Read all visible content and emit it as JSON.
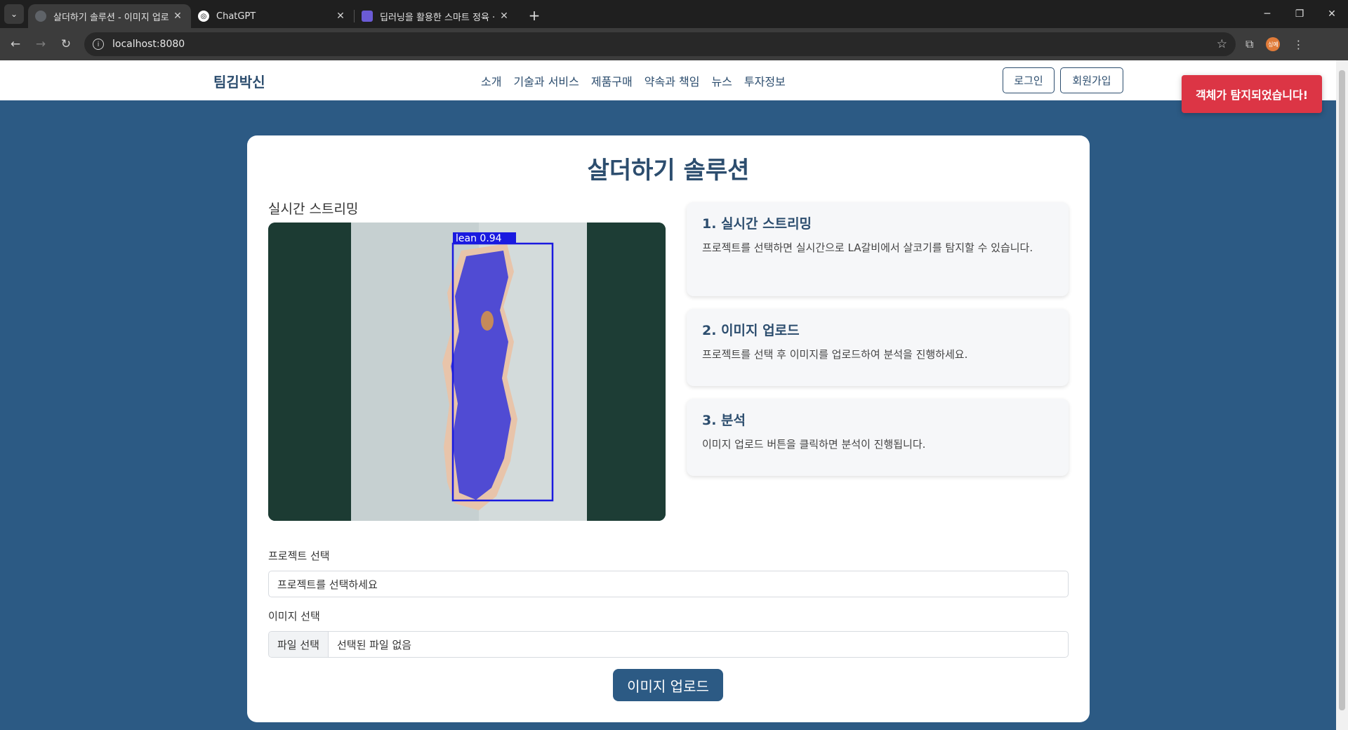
{
  "browser": {
    "tabs": [
      {
        "title": "살더하기 솔루션 - 이미지 업로",
        "active": true
      },
      {
        "title": "ChatGPT",
        "active": false
      },
      {
        "title": "딥러닝을 활용한 스마트 정육 ·",
        "active": false
      }
    ],
    "url": "localhost:8080",
    "profile_label": "싱예"
  },
  "site": {
    "brand": "팀김박신",
    "menu": [
      "소개",
      "기술과 서비스",
      "제품구매",
      "약속과 책임",
      "뉴스",
      "투자정보"
    ],
    "login": "로그인",
    "signup": "회원가입"
  },
  "alert": "객체가 탐지되었습니다!",
  "page": {
    "title": "살더하기 솔루션",
    "stream_label": "실시간 스트리밍",
    "detection": {
      "label": "lean 0.94",
      "confidence": 0.94
    },
    "steps": [
      {
        "title": "1. 실시간 스트리밍",
        "desc": "프로젝트를 선택하면 실시간으로 LA갈비에서 살코기를 탐지할 수 있습니다."
      },
      {
        "title": "2. 이미지 업로드",
        "desc": "프로젝트를 선택 후 이미지를 업로드하여 분석을 진행하세요."
      },
      {
        "title": "3. 분석",
        "desc": "이미지 업로드 버튼을 클릭하면 분석이 진행됩니다."
      }
    ],
    "project_label": "프로젝트 선택",
    "project_placeholder": "프로젝트를 선택하세요",
    "image_label": "이미지 선택",
    "file_button": "파일 선택",
    "file_status": "선택된 파일 없음",
    "upload_button": "이미지 업로드"
  },
  "colors": {
    "page_bg": "#2c5a84",
    "brand": "#2c4d6e",
    "alert": "#dc3545",
    "mask": "#3a3ad8",
    "bbox": "#1a1ae0"
  }
}
